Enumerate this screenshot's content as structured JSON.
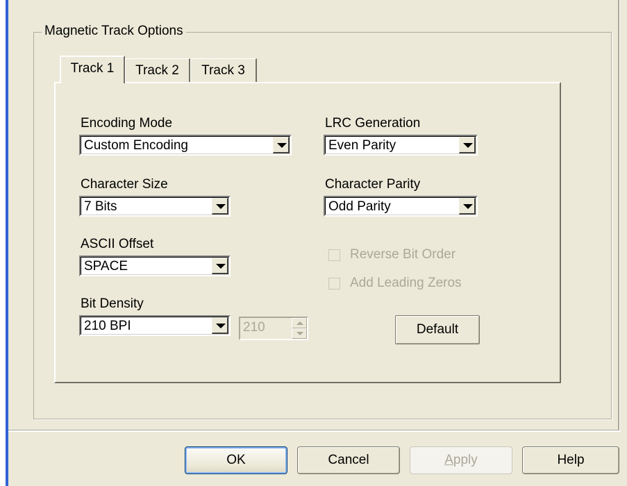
{
  "group": {
    "title": "Magnetic Track Options"
  },
  "tabs": [
    {
      "label": "Track 1",
      "active": true
    },
    {
      "label": "Track 2",
      "active": false
    },
    {
      "label": "Track 3",
      "active": false
    }
  ],
  "fields": {
    "encoding_mode": {
      "label": "Encoding Mode",
      "value": "Custom Encoding"
    },
    "character_size": {
      "label": "Character Size",
      "value": "7 Bits"
    },
    "ascii_offset": {
      "label": "ASCII Offset",
      "value": "SPACE"
    },
    "bit_density": {
      "label": "Bit Density",
      "value": "210 BPI",
      "spin_value": "210"
    },
    "lrc_generation": {
      "label": "LRC Generation",
      "value": "Even Parity"
    },
    "character_parity": {
      "label": "Character Parity",
      "value": "Odd Parity"
    }
  },
  "checkboxes": {
    "reverse_bit_order": {
      "label": "Reverse Bit Order",
      "checked": false,
      "enabled": false
    },
    "add_leading_zeros": {
      "label": "Add Leading Zeros",
      "checked": false,
      "enabled": false
    }
  },
  "buttons": {
    "default": "Default",
    "ok": "OK",
    "cancel": "Cancel",
    "apply_prefix": "",
    "apply_mnemonic": "A",
    "apply_rest": "pply",
    "help": "Help"
  },
  "colors": {
    "dialog_bg": "#ece9d8",
    "window_frame": "#2f63d6",
    "disabled_text": "#aca899"
  },
  "icons": {
    "dropdown": "chevron-down-icon",
    "spin_up": "triangle-up-icon",
    "spin_down": "triangle-down-icon"
  }
}
